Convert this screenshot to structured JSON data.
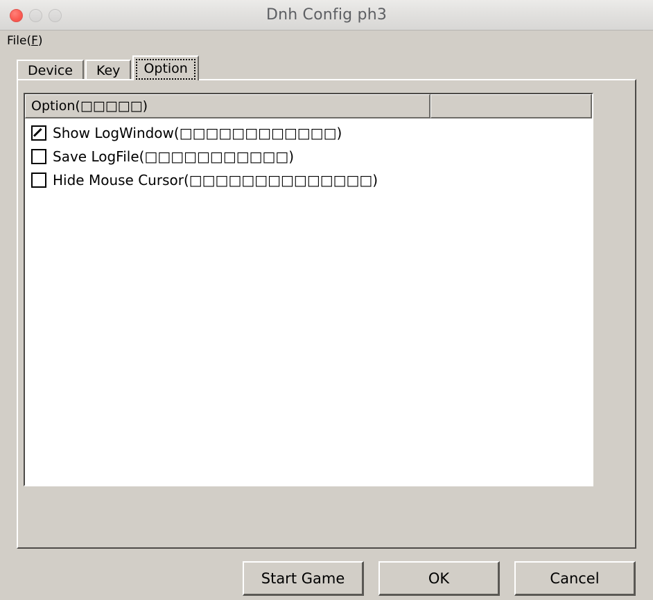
{
  "window": {
    "title": "Dnh Config ph3",
    "traffic_lights": [
      {
        "name": "close",
        "color": "#fb5c53",
        "enabled": true
      },
      {
        "name": "minimize",
        "color": "#d5d4d3",
        "enabled": false
      },
      {
        "name": "maximize",
        "color": "#d5d4d3",
        "enabled": false
      }
    ],
    "titlebar_text_color": "#5d5f63",
    "face_color": "#d2cec7"
  },
  "menubar": {
    "items": [
      {
        "label_before": "File(",
        "mnemonic": "F",
        "label_after": ")"
      }
    ]
  },
  "tabs": [
    {
      "id": "device",
      "label": "Device",
      "active": false
    },
    {
      "id": "key",
      "label": "Key",
      "active": false
    },
    {
      "id": "option",
      "label": "Option",
      "active": true
    }
  ],
  "list": {
    "columns": [
      {
        "id": "option",
        "label": "Option(□□□□□)"
      },
      {
        "id": "blank",
        "label": ""
      }
    ],
    "rows": [
      {
        "id": "show-logwindow",
        "label": "Show LogWindow(□□□□□□□□□□□□)",
        "checked": true
      },
      {
        "id": "save-logfile",
        "label": "Save LogFile(□□□□□□□□□□□)",
        "checked": false
      },
      {
        "id": "hide-mouse-cursor",
        "label": "Hide Mouse Cursor(□□□□□□□□□□□□□□)",
        "checked": false
      }
    ]
  },
  "buttons": {
    "start_game": "Start Game",
    "ok": "OK",
    "cancel": "Cancel"
  }
}
